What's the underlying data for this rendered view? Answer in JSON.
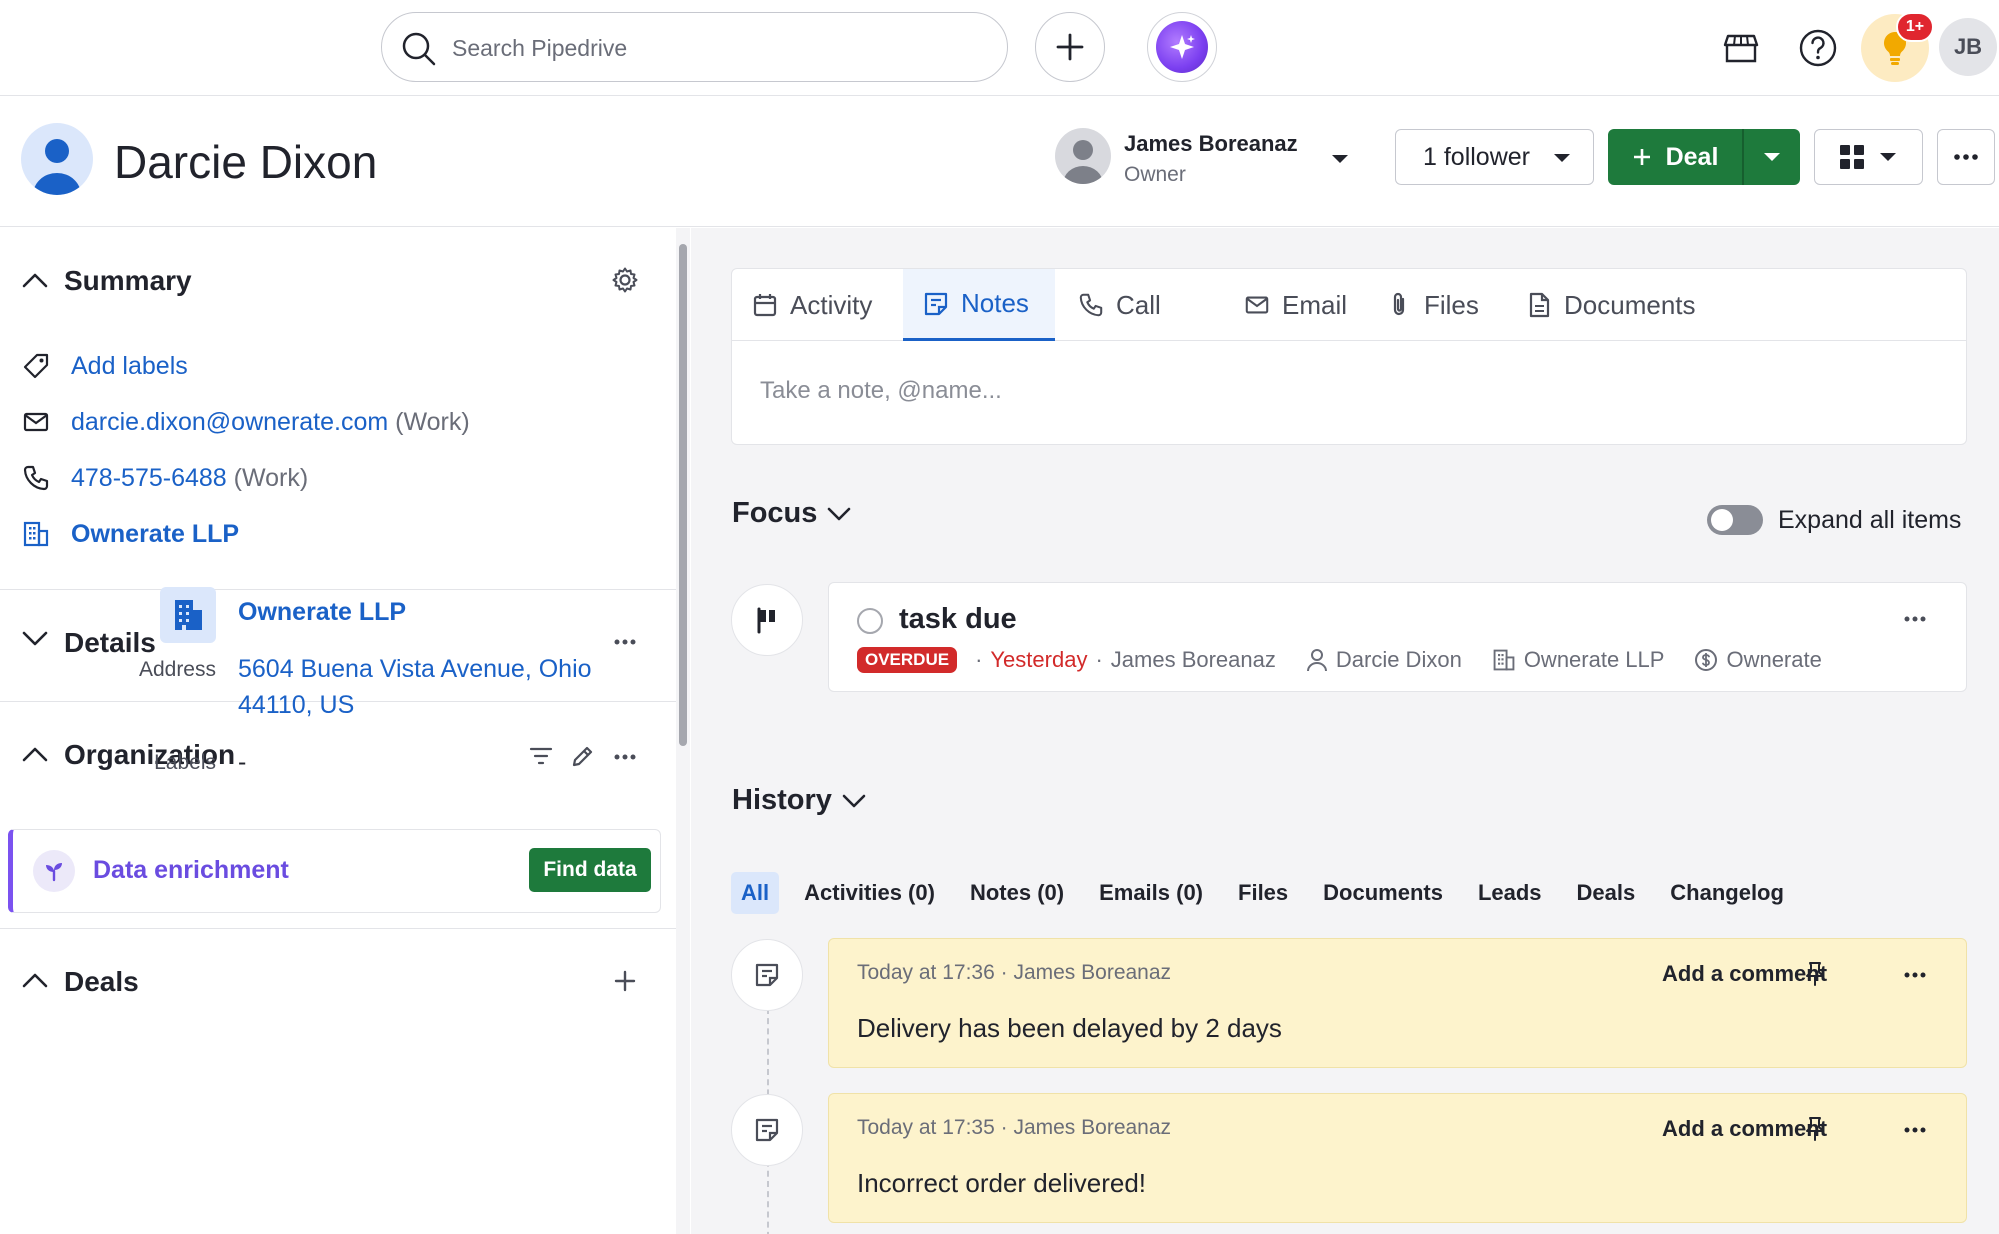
{
  "topbar": {
    "search_placeholder": "Search Pipedrive",
    "notification_count": "1+",
    "user_initials": "JB"
  },
  "person": {
    "name": "Darcie Dixon",
    "owner_name": "James Boreanaz",
    "owner_role": "Owner",
    "follower_label": "1 follower",
    "deal_button": "Deal"
  },
  "summary": {
    "title": "Summary",
    "add_labels": "Add labels",
    "email": "darcie.dixon@ownerate.com",
    "email_type": "(Work)",
    "phone": "478-575-6488",
    "phone_type": "(Work)",
    "org": "Ownerate LLP"
  },
  "details": {
    "title": "Details"
  },
  "organization": {
    "title": "Organization",
    "name": "Ownerate LLP",
    "address_label": "Address",
    "address_line1": "5604 Buena Vista Avenue, Ohio",
    "address_line2": "44110, US",
    "labels_label": "Labels",
    "labels_value": "-"
  },
  "enrichment": {
    "label": "Data enrichment",
    "button": "Find data"
  },
  "deals": {
    "title": "Deals"
  },
  "composer": {
    "tabs": [
      "Activity",
      "Notes",
      "Call",
      "Email",
      "Files",
      "Documents"
    ],
    "active_tab": "Notes",
    "placeholder": "Take a note, @name..."
  },
  "focus": {
    "title": "Focus",
    "expand_label": "Expand all items",
    "task": {
      "title": "task due",
      "status": "OVERDUE",
      "when": "Yesterday",
      "assignee": "James Boreanaz",
      "person": "Darcie Dixon",
      "org": "Ownerate LLP",
      "deal": "Ownerate"
    }
  },
  "history": {
    "title": "History",
    "tabs": [
      "All",
      "Activities (0)",
      "Notes (0)",
      "Emails (0)",
      "Files",
      "Documents",
      "Leads",
      "Deals",
      "Changelog"
    ],
    "active_tab": "All",
    "notes": [
      {
        "time": "Today at 17:36",
        "author": "James Boreanaz",
        "body": "Delivery has been delayed by 2 days",
        "comment_label": "Add a comment"
      },
      {
        "time": "Today at 17:35",
        "author": "James Boreanaz",
        "body": "Incorrect order delivered!",
        "comment_label": "Add a comment"
      }
    ]
  },
  "colors": {
    "brand_green": "#1e7a3c",
    "link_blue": "#1a61c7",
    "overdue_red": "#d22a2a",
    "note_yellow": "#fdf3cc"
  }
}
